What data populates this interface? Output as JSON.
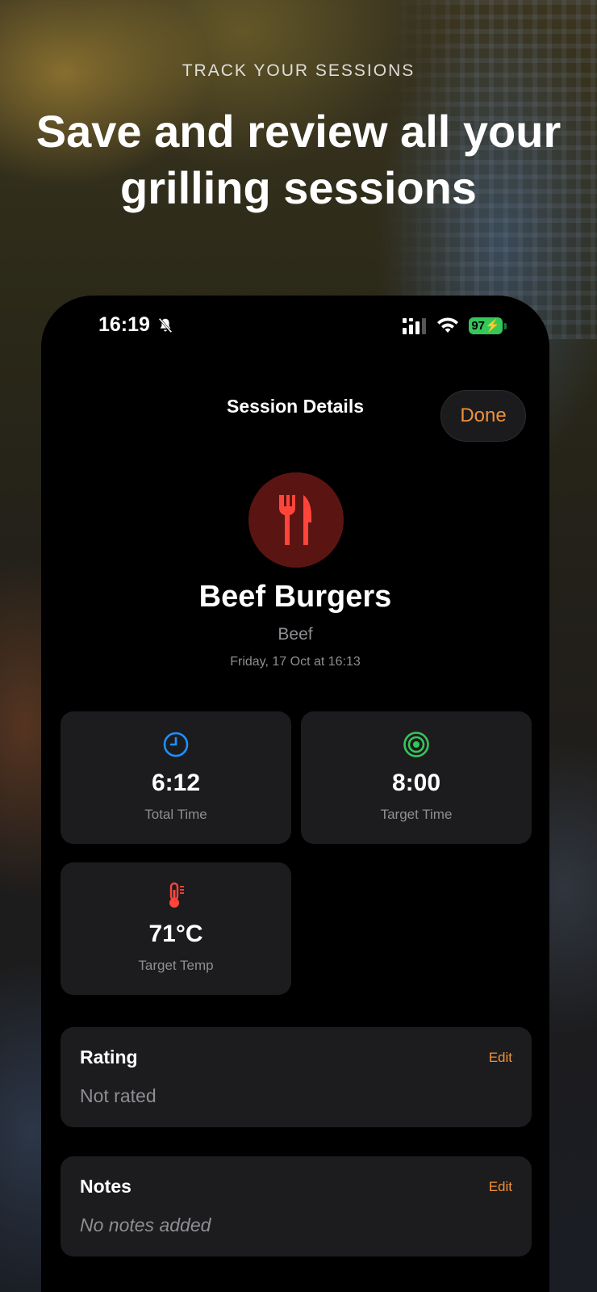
{
  "hero": {
    "eyebrow": "TRACK YOUR SESSIONS",
    "headline": "Save and review all your grilling sessions"
  },
  "status_bar": {
    "time": "16:19",
    "battery": "97"
  },
  "nav": {
    "title": "Session Details",
    "done_label": "Done"
  },
  "session": {
    "name": "Beef Burgers",
    "category": "Beef",
    "datetime": "Friday, 17 Oct at 16:13",
    "icon": "fork-knife-icon"
  },
  "stats": [
    {
      "value": "6:12",
      "label": "Total Time",
      "icon": "clock-icon",
      "color": "#1e90ff"
    },
    {
      "value": "8:00",
      "label": "Target Time",
      "icon": "target-icon",
      "color": "#34c759"
    },
    {
      "value": "71°C",
      "label": "Target Temp",
      "icon": "thermometer-icon",
      "color": "#ff453a"
    }
  ],
  "rating": {
    "title": "Rating",
    "edit_label": "Edit",
    "value": "Not rated"
  },
  "notes": {
    "title": "Notes",
    "edit_label": "Edit",
    "value": "No notes added"
  },
  "colors": {
    "accent": "#f0913a",
    "card": "#1c1c1e",
    "icon_bg": "#5a1512",
    "icon_fg": "#ff453a"
  }
}
